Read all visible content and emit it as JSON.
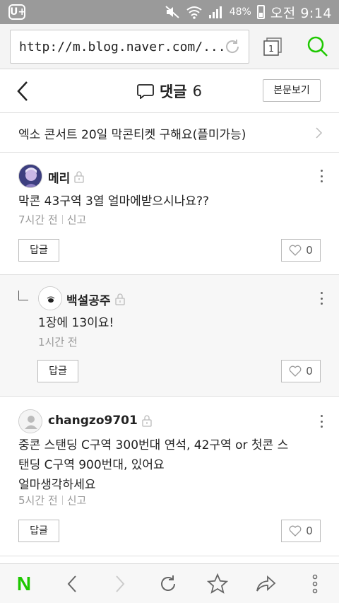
{
  "status_bar": {
    "battery_percent": "48%",
    "time": "오전 9:14",
    "logo": "U+"
  },
  "url_bar": {
    "url": "http://m.blog.naver.com/...",
    "tab_count": "1"
  },
  "header": {
    "title": "댓글",
    "count": "6",
    "view_post_label": "본문보기"
  },
  "post": {
    "title": "엑소 콘서트 20일 막콘티켓 구해요(플미가능)"
  },
  "comments": [
    {
      "author": "메리",
      "text": "막콘 43구역 3열 얼마에받으시나요??",
      "time": "7시간 전",
      "report": "신고",
      "reply_label": "답글",
      "likes": "0",
      "is_reply": false
    },
    {
      "author": "백설공주",
      "text": "1장에 13이요!",
      "time": "1시간 전",
      "reply_label": "답글",
      "likes": "0",
      "is_reply": true
    },
    {
      "author": "changzo9701",
      "text_line1": "중콘 스탠딩 C구역 300번대 연석, 42구역 or 첫콘 스",
      "text_line2": "탠딩 C구역 900번대, 있어요",
      "text_line3": "얼마생각하세요",
      "time": "5시간 전",
      "report": "신고",
      "reply_label": "답글",
      "likes": "0",
      "is_reply": false
    }
  ],
  "colors": {
    "brand_green": "#1ec800",
    "status_bar": "#9a9a9a"
  },
  "toolbar": {
    "logo": "N",
    "icons": [
      "naver-logo",
      "back-icon",
      "forward-icon",
      "refresh-icon",
      "star-icon",
      "share-icon",
      "more-icon"
    ]
  }
}
